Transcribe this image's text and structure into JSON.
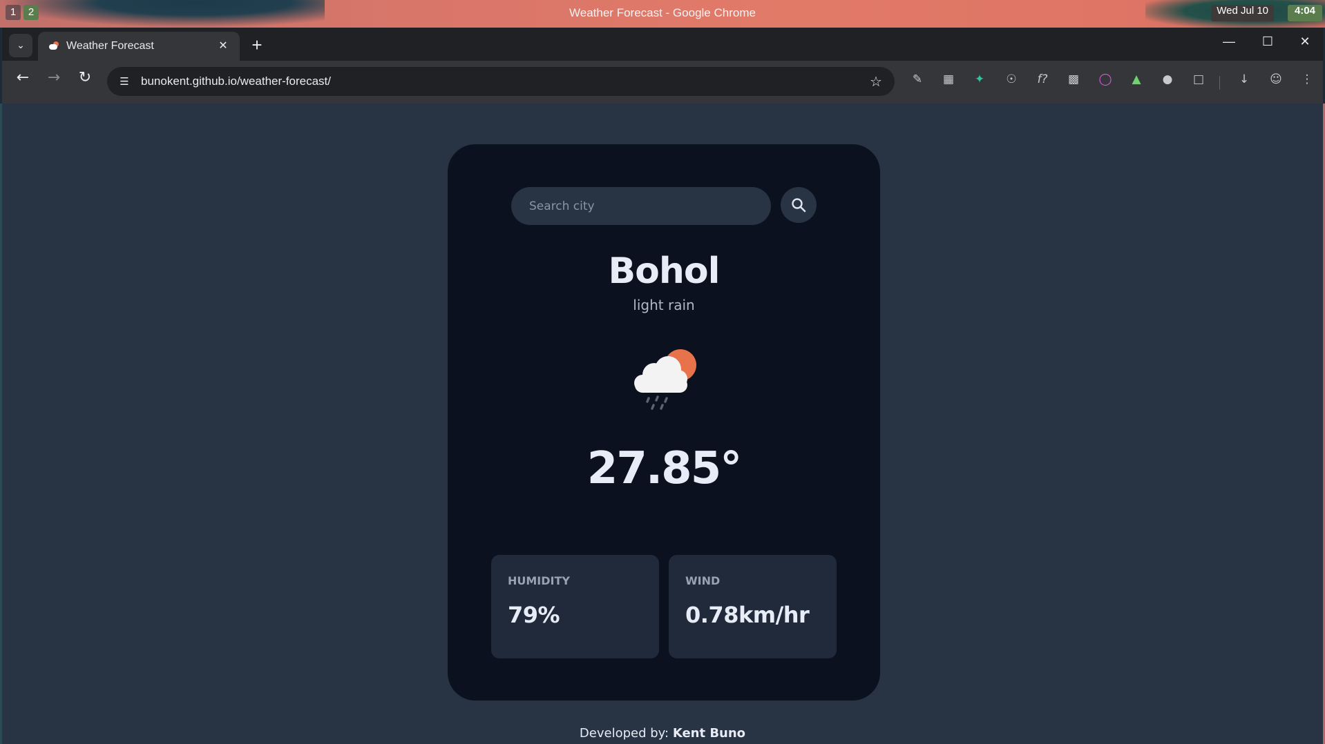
{
  "desktop": {
    "workspaces": [
      "1",
      "2"
    ],
    "window_title": "Weather Forecast - Google Chrome",
    "date": "Wed Jul 10",
    "time": "4:04"
  },
  "browser": {
    "tab_title": "Weather Forecast",
    "url": "bunokent.github.io/weather-forecast/",
    "accent": "#e8734a"
  },
  "weather": {
    "search_placeholder": "Search city",
    "city": "Bohol",
    "description": "light rain",
    "icon": "rain-cloud-sun-icon",
    "temperature": "27.85°",
    "humidity_label": "HUMIDITY",
    "humidity_value": "79%",
    "wind_label": "WIND",
    "wind_value": "0.78km/hr"
  },
  "footer": {
    "prefix": "Developed by: ",
    "author": "Kent Buno"
  }
}
